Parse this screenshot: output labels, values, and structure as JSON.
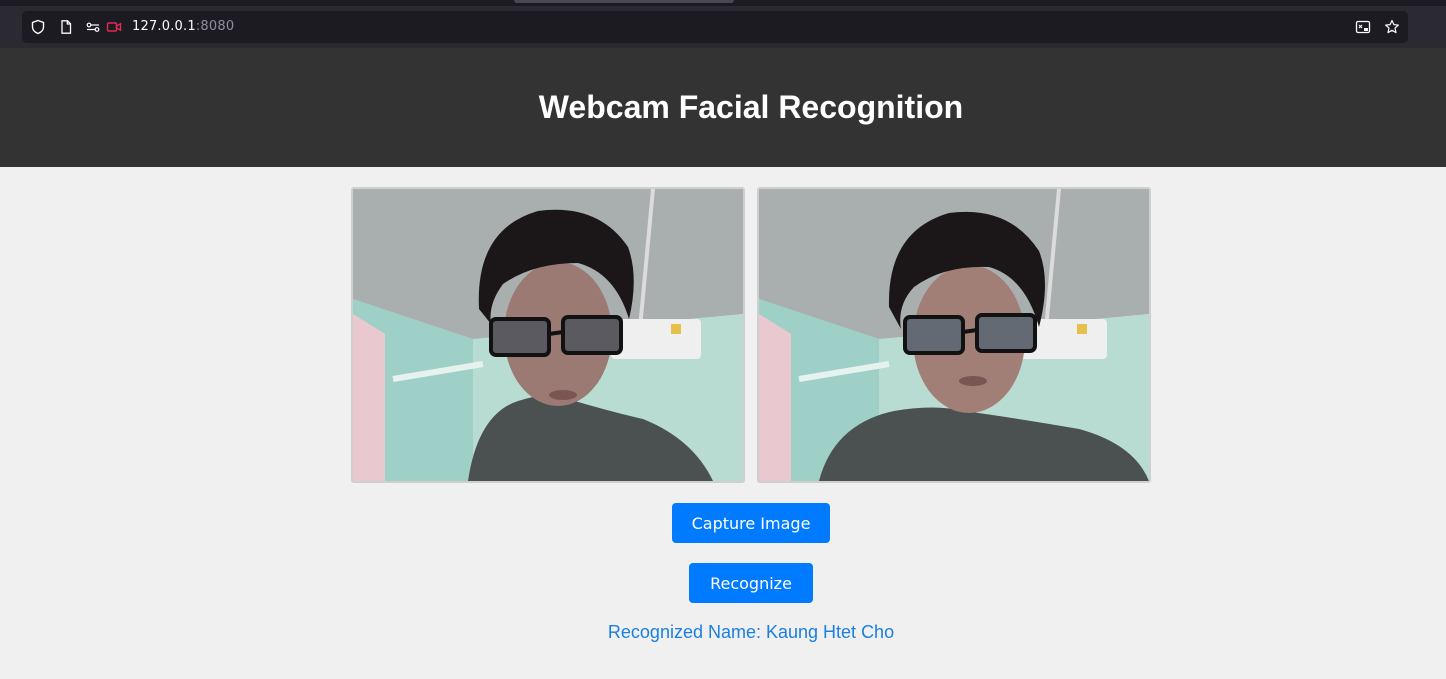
{
  "browser": {
    "url_host": "127.0.0.1",
    "url_port": ":8080",
    "icons": [
      "shield-icon",
      "page-icon",
      "permissions-icon",
      "camera-active-icon",
      "reader-mode-icon",
      "bookmark-star-icon"
    ],
    "camera_indicator_color": "#e22850"
  },
  "header": {
    "title": "Webcam Facial Recognition",
    "background": "#333333"
  },
  "video": {
    "live_feed_label": "",
    "captured_label": ""
  },
  "actions": {
    "capture_label": "Capture Image",
    "recognize_label": "Recognize",
    "button_color": "#007bff"
  },
  "result": {
    "prefix": "Recognized Name: ",
    "name": "Kaung Htet Cho",
    "color": "#1a7fe0"
  }
}
